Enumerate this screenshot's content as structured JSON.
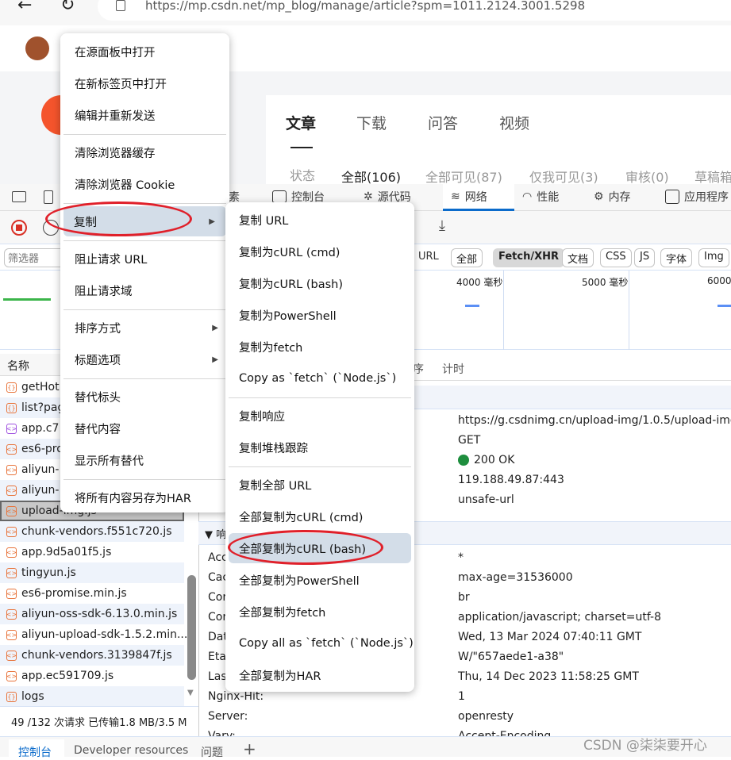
{
  "browser": {
    "url": "https://mp.csdn.net/mp_blog/manage/article?spm=1011.2124.3001.5298",
    "back_icon": "arrow-left-icon",
    "reload_icon": "reload-icon"
  },
  "site": {
    "content_tabs": [
      "文章",
      "下载",
      "问答",
      "视频"
    ],
    "status_label": "状态",
    "status_filters": [
      "全部(106)",
      "全部可见(87)",
      "仅我可见(3)",
      "审核(0)",
      "草稿箱"
    ]
  },
  "devtools": {
    "tabs": [
      {
        "label": "素",
        "icon": ""
      },
      {
        "label": "控制台",
        "icon": "console-icon"
      },
      {
        "label": "源代码",
        "icon": "bug-icon"
      },
      {
        "label": "网络",
        "icon": "wifi-icon"
      },
      {
        "label": "性能",
        "icon": "gauge-icon"
      },
      {
        "label": "内存",
        "icon": "chip-icon"
      },
      {
        "label": "应用程序",
        "icon": "window-icon"
      }
    ],
    "active_tab": "网络",
    "accent": "#0b6bcb",
    "filter_placeholder": "筛选器",
    "url_label": "URL",
    "type_filters": [
      "全部",
      "Fetch/XHR",
      "文档",
      "CSS",
      "JS",
      "字体",
      "Img"
    ],
    "active_filter": "Fetch/XHR",
    "timeline_labels": [
      "4000  毫秒",
      "5000  毫秒",
      "6000"
    ],
    "name_column": "名称",
    "detail_tabs": [
      "序",
      "计时"
    ],
    "requests": [
      "getHot",
      "list?pag",
      "app.c7",
      "es6-pro",
      "aliyun-",
      "aliyun-",
      "upload-img.js",
      "chunk-vendors.f551c720.js",
      "app.9d5a01f5.js",
      "tingyun.js",
      "es6-promise.min.js",
      "aliyun-oss-sdk-6.13.0.min.js",
      "aliyun-upload-sdk-1.5.2.min...",
      "chunk-vendors.3139847f.js",
      "app.ec591709.js",
      "logs"
    ],
    "selected_request": "upload-img.js",
    "status_bar": "49 /132 次请求  已传输1.8 MB/3.5 M",
    "general_values": [
      "https://g.csdnimg.cn/upload-img/1.0.5/upload-img.js",
      "GET",
      "200 OK",
      "119.188.49.87:443",
      "unsafe-url"
    ],
    "status_color": "#1e8e3e",
    "response_section": "▼ 响",
    "response_headers": [
      {
        "key": "Acc",
        "value": "*"
      },
      {
        "key": "Cac",
        "value": "max-age=31536000"
      },
      {
        "key": "Cor",
        "value": "br"
      },
      {
        "key": "Cor",
        "value": "application/javascript; charset=utf-8"
      },
      {
        "key": "Dat",
        "value": "Wed, 13 Mar 2024 07:40:11 GMT"
      },
      {
        "key": "Eta",
        "value": "W/\"657aede1-a38\""
      },
      {
        "key": "Las",
        "value": "Thu, 14 Dec 2023 11:58:25 GMT"
      },
      {
        "key": "Nginx-Hit:",
        "value": "1"
      },
      {
        "key": "Server:",
        "value": "openresty"
      },
      {
        "key": "Vary:",
        "value": "Accept-Encoding"
      }
    ],
    "drawer_tabs": [
      "控制台",
      "Developer resources",
      "问题",
      "+"
    ]
  },
  "context_menu": {
    "items": [
      {
        "label": "在源面板中打开"
      },
      {
        "label": "在新标签页中打开"
      },
      {
        "label": "编辑并重新发送"
      },
      {
        "sep": true
      },
      {
        "label": "清除浏览器缓存"
      },
      {
        "label": "清除浏览器 Cookie"
      },
      {
        "sep": true
      },
      {
        "label": "复制",
        "submenu": true,
        "highlighted": true
      },
      {
        "sep": true
      },
      {
        "label": "阻止请求 URL"
      },
      {
        "label": "阻止请求域"
      },
      {
        "sep": true
      },
      {
        "label": "排序方式",
        "submenu": true
      },
      {
        "label": "标题选项",
        "submenu": true
      },
      {
        "sep": true
      },
      {
        "label": "替代标头"
      },
      {
        "label": "替代内容"
      },
      {
        "label": "显示所有替代"
      },
      {
        "sep": true
      },
      {
        "label": "将所有内容另存为HAR"
      }
    ]
  },
  "copy_submenu": {
    "items": [
      {
        "label": "复制 URL"
      },
      {
        "label": "复制为cURL (cmd)"
      },
      {
        "label": "复制为cURL (bash)"
      },
      {
        "label": "复制为PowerShell"
      },
      {
        "label": "复制为fetch"
      },
      {
        "label": "Copy as `fetch` (`Node.js`)"
      },
      {
        "sep": true
      },
      {
        "label": "复制响应"
      },
      {
        "label": "复制堆栈跟踪"
      },
      {
        "sep": true
      },
      {
        "label": "复制全部 URL"
      },
      {
        "label": "全部复制为cURL (cmd)"
      },
      {
        "label": "全部复制为cURL (bash)",
        "highlighted": true
      },
      {
        "label": "全部复制为PowerShell"
      },
      {
        "label": "全部复制为fetch"
      },
      {
        "label": "Copy all as `fetch` (`Node.js`)"
      },
      {
        "label": "全部复制为HAR"
      }
    ]
  },
  "annotation_color": "#e0202a",
  "watermark": "CSDN @柒柒要开心"
}
